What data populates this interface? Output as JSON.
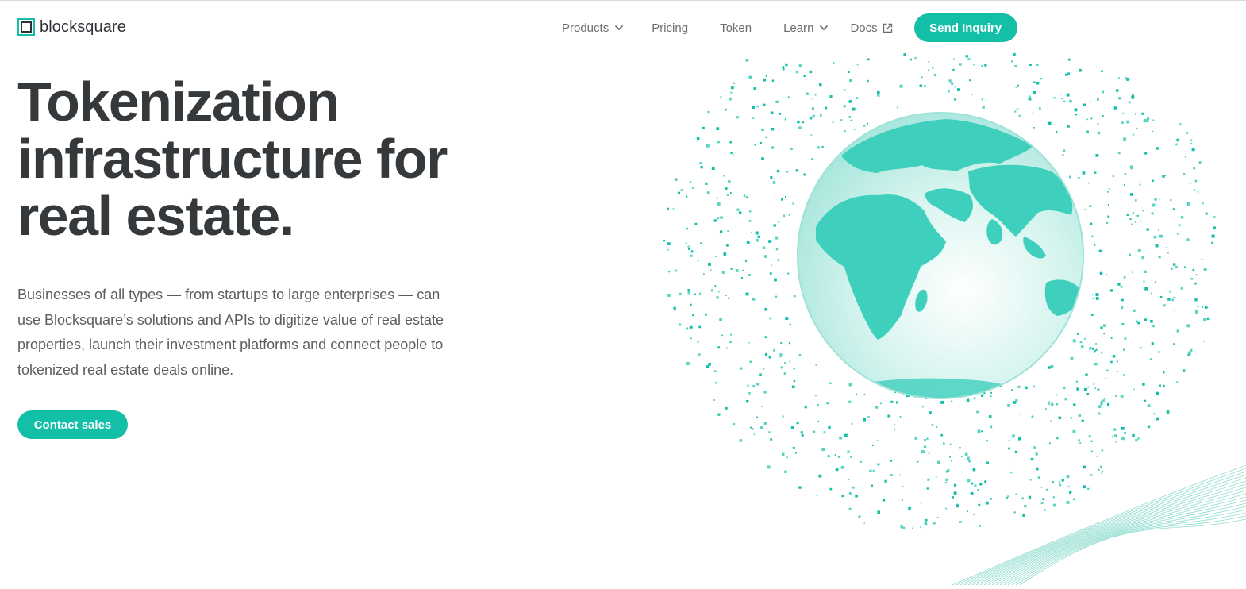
{
  "brand": {
    "name": "blocksquare"
  },
  "nav": {
    "products": "Products",
    "pricing": "Pricing",
    "token": "Token",
    "learn": "Learn",
    "docs": "Docs",
    "cta": "Send Inquiry"
  },
  "hero": {
    "title_line1": "Tokenization",
    "title_line2": "infrastructure for",
    "title_line3": "real estate.",
    "description": "Businesses of all types — from startups to large enterprises — can use Blocksquare’s solutions and APIs to digitize value of real estate properties, launch their investment platforms and connect people to tokenized real estate deals online.",
    "cta": "Contact sales"
  },
  "icons": {
    "products_chevron": "chevron-down-icon",
    "learn_chevron": "chevron-down-icon",
    "docs_external": "external-link-icon",
    "logo": "blocksquare-logo-icon",
    "illustration": "globe-illustration"
  },
  "colors": {
    "accent": "#14bfa8",
    "heading": "#36393c",
    "body": "#5b5e61",
    "nav": "#6b6e71",
    "globe_land": "#3ecfbd",
    "globe_sea": "#c8efe9"
  }
}
